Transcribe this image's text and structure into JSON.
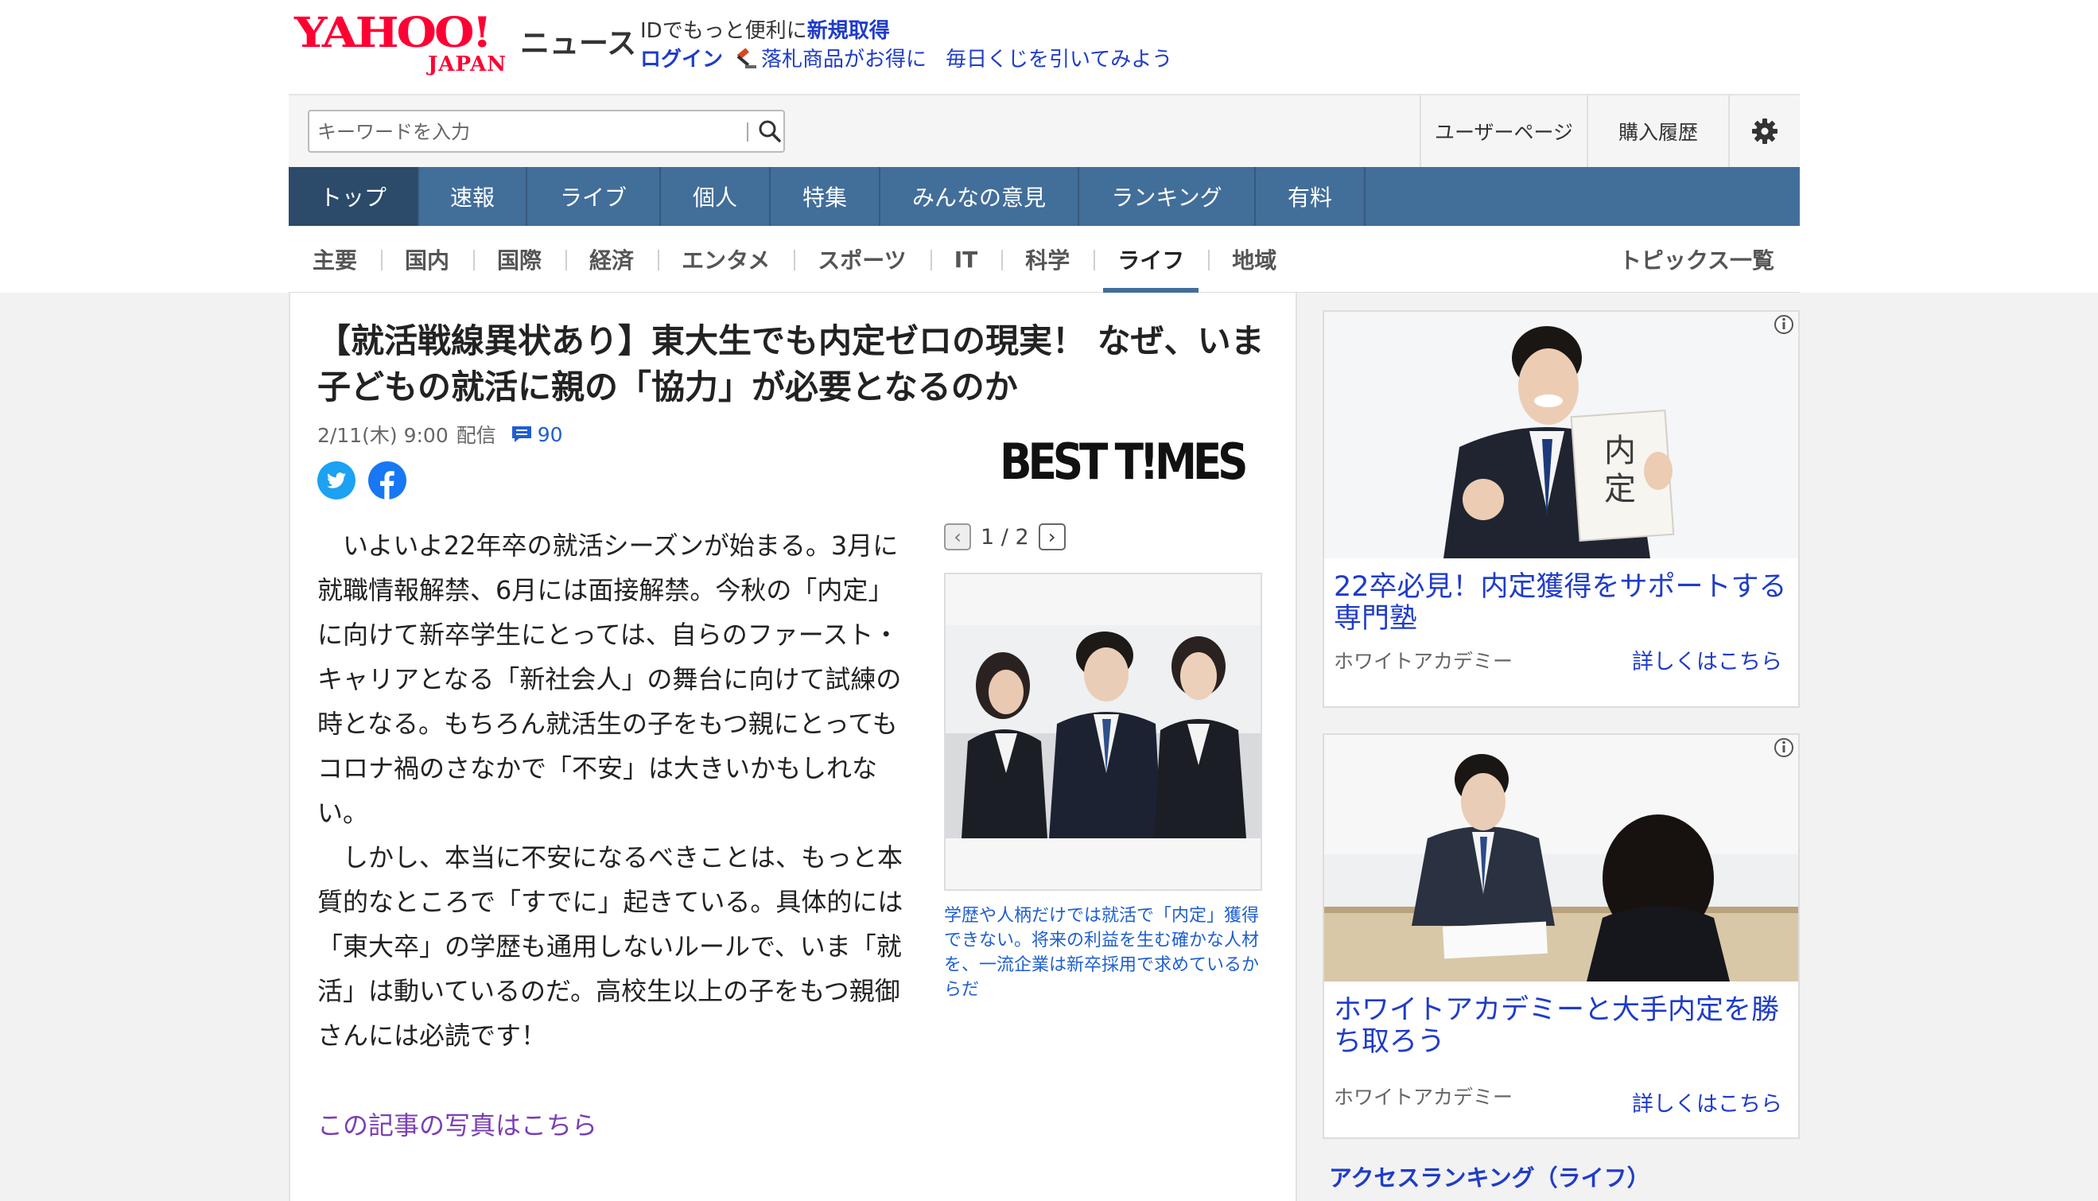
{
  "header": {
    "logo": "YAHOO!",
    "logo_sub": "JAPAN",
    "service_name": "ニュース",
    "promo_text": "IDでもっと便利に",
    "promo_link": "新規取得",
    "login": "ログイン",
    "auction_promo": "落札商品がお得に",
    "lottery_promo": "毎日くじを引いてみよう"
  },
  "search": {
    "placeholder": "キーワードを入力",
    "icon": "search-icon"
  },
  "user_links": {
    "user_page": "ユーザーページ",
    "purchase_history": "購入履歴",
    "settings_icon": "gear-icon"
  },
  "main_nav": [
    "トップ",
    "速報",
    "ライブ",
    "個人",
    "特集",
    "みんなの意見",
    "ランキング",
    "有料"
  ],
  "main_nav_active": "トップ",
  "sub_nav": [
    "主要",
    "国内",
    "国際",
    "経済",
    "エンタメ",
    "スポーツ",
    "IT",
    "科学",
    "ライフ",
    "地域"
  ],
  "sub_nav_active": "ライフ",
  "topics_link": "トピックス一覧",
  "article": {
    "headline_line1": "【就活戦線異状あり】東大生でも内定ゼロの現実！ なぜ、いま",
    "headline_line2": "子どもの就活に親の「協力」が必要となるのか",
    "date": "2/11(木) 9:00",
    "delivery": "配信",
    "comment_count": "90",
    "publisher": "BEST T!MES",
    "paragraph1": "いよいよ22年卒の就活シーズンが始まる。3月に就職情報解禁、6月には面接解禁。今秋の「内定」に向けて新卒学生にとっては、自らのファースト・キャリアとなる「新社会人」の舞台に向けて試練の時となる。もちろん就活生の子をもつ親にとってもコロナ禍のさなかで「不安」は大きいかもしれない。",
    "paragraph2": "しかし、本当に不安になるべきことは、もっと本質的なところで「すでに」起きている。具体的には「東大卒」の学歴も通用しないルールで、いま「就活」は動いているのだ。高校生以上の子をもつ親御さんには必読です！",
    "photo_link": "この記事の写真はこちら",
    "pager": "1 / 2",
    "caption": "学歴や人柄だけでは就活で「内定」獲得できない。将来の利益を生む確かな人材を、一流企業は新卒採用で求めているからだ"
  },
  "ads": [
    {
      "title": "22卒必見！内定獲得をサポートする専門塾",
      "sponsor": "ホワイトアカデミー",
      "cta": "詳しくはこちら"
    },
    {
      "title": "ホワイトアカデミーと大手内定を勝ち取ろう",
      "sponsor": "ホワイトアカデミー",
      "cta": "詳しくはこちら"
    }
  ],
  "ranking_title": "アクセスランキング（ライフ）",
  "colors": {
    "brand_red": "#ff0033",
    "nav_blue": "#426e9a",
    "link_blue": "#1f3cc8",
    "visited_purple": "#7b3fb5"
  }
}
